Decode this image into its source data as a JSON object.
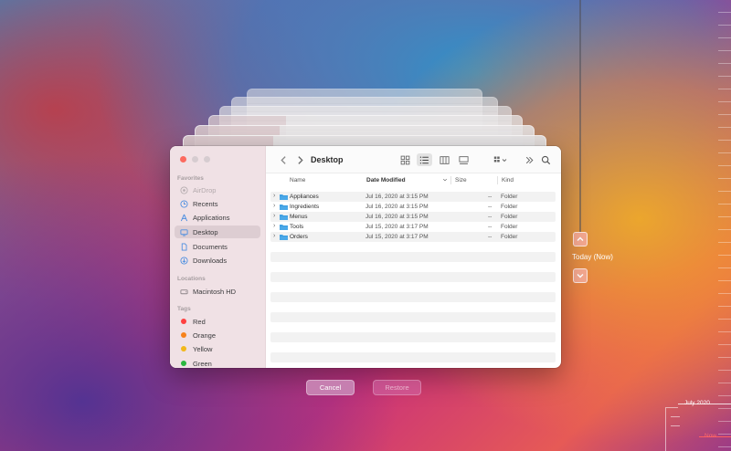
{
  "finder": {
    "title": "Desktop",
    "back_icon": "chevron-left-icon",
    "forward_icon": "chevron-right-icon"
  },
  "sidebar": {
    "favorites_label": "Favorites",
    "favorites": [
      {
        "label": "AirDrop",
        "icon": "airdrop-icon"
      },
      {
        "label": "Recents",
        "icon": "clock-icon"
      },
      {
        "label": "Applications",
        "icon": "applications-icon"
      },
      {
        "label": "Desktop",
        "icon": "desktop-icon"
      },
      {
        "label": "Documents",
        "icon": "document-icon"
      },
      {
        "label": "Downloads",
        "icon": "download-icon"
      }
    ],
    "locations_label": "Locations",
    "locations": [
      {
        "label": "Macintosh HD",
        "icon": "hard-drive-icon"
      }
    ],
    "tags_label": "Tags",
    "tags": [
      {
        "label": "Red",
        "color": "#ff4040"
      },
      {
        "label": "Orange",
        "color": "#f7821b"
      },
      {
        "label": "Yellow",
        "color": "#f2b81a"
      },
      {
        "label": "Green",
        "color": "#2bb640"
      }
    ]
  },
  "columns": {
    "name": "Name",
    "date_modified": "Date Modified",
    "size": "Size",
    "kind": "Kind"
  },
  "files": [
    {
      "name": "Appliances",
      "date": "Jul 16, 2020 at 3:15 PM",
      "size": "--",
      "kind": "Folder"
    },
    {
      "name": "Ingredients",
      "date": "Jul 16, 2020 at 3:15 PM",
      "size": "--",
      "kind": "Folder"
    },
    {
      "name": "Menus",
      "date": "Jul 16, 2020 at 3:15 PM",
      "size": "--",
      "kind": "Folder"
    },
    {
      "name": "Tools",
      "date": "Jul 15, 2020 at 3:17 PM",
      "size": "--",
      "kind": "Folder"
    },
    {
      "name": "Orders",
      "date": "Jul 15, 2020 at 3:17 PM",
      "size": "--",
      "kind": "Folder"
    }
  ],
  "buttons": {
    "cancel": "Cancel",
    "restore": "Restore"
  },
  "timeline": {
    "today_label": "Today (Now)",
    "month_label": "July 2020",
    "now_label": "Now"
  },
  "colors": {
    "folder": "#4aa8e8",
    "sidebar_selected": "#ddcdd2",
    "now_marker": "#ff5e5e"
  }
}
